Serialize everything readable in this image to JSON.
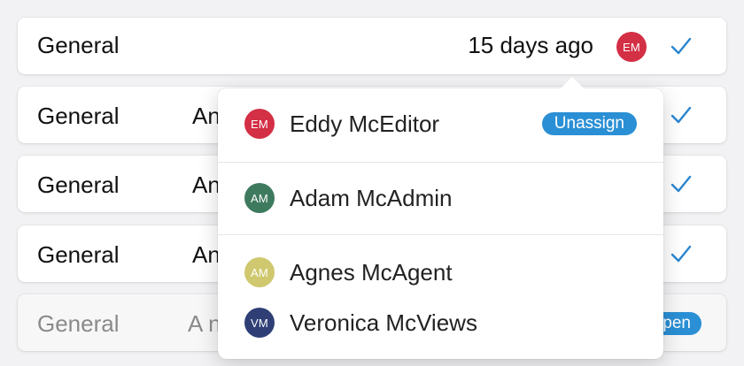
{
  "rows": [
    {
      "category": "General",
      "timestamp": "15 days ago",
      "assignee_initials": "EM"
    },
    {
      "category": "General",
      "subject": "An"
    },
    {
      "category": "General",
      "subject": "An"
    },
    {
      "category": "General",
      "subject": "An"
    },
    {
      "category": "General",
      "subject": "A n",
      "status": "Open"
    }
  ],
  "assignee_menu": {
    "items": [
      {
        "initials": "EM",
        "name": "Eddy McEditor",
        "color": "#d32f45",
        "action": "Unassign"
      },
      {
        "initials": "AM",
        "name": "Adam McAdmin",
        "color": "#3e7a5e"
      },
      {
        "initials": "AM",
        "name": "Agnes McAgent",
        "color": "#cfc86f"
      },
      {
        "initials": "VM",
        "name": "Veronica McViews",
        "color": "#2f3f76"
      }
    ]
  },
  "colors": {
    "accent": "#2a8fd4",
    "check": "#2a86d0",
    "assignee_avatar": "#d32f45"
  },
  "icons": {
    "check": "check-icon",
    "caret": "caret-up-icon"
  }
}
